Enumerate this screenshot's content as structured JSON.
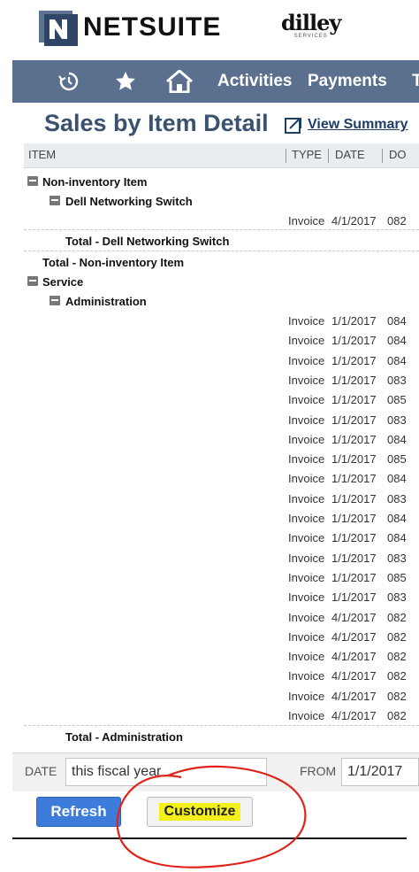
{
  "brand": {
    "logo_name": "NETSUITE",
    "partner_name": "dilley",
    "partner_sub": "SERVICES"
  },
  "nav": {
    "activities": "Activities",
    "payments": "Payments",
    "overflow": "T"
  },
  "page": {
    "title": "Sales by Item Detail",
    "view_summary": "View Summary"
  },
  "columns": {
    "item": "ITEM",
    "type": "TYPE",
    "date": "DATE",
    "doc": "DO"
  },
  "groups": {
    "noninventory": "Non-inventory Item",
    "dell": "Dell Networking Switch",
    "total_dell": "Total - Dell Networking Switch",
    "total_noninventory": "Total - Non-inventory Item",
    "service": "Service",
    "administration": "Administration",
    "total_administration": "Total - Administration"
  },
  "dell_rows": [
    {
      "type": "Invoice",
      "date": "4/1/2017",
      "doc": "082"
    }
  ],
  "admin_rows": [
    {
      "type": "Invoice",
      "date": "1/1/2017",
      "doc": "084"
    },
    {
      "type": "Invoice",
      "date": "1/1/2017",
      "doc": "084"
    },
    {
      "type": "Invoice",
      "date": "1/1/2017",
      "doc": "084"
    },
    {
      "type": "Invoice",
      "date": "1/1/2017",
      "doc": "083"
    },
    {
      "type": "Invoice",
      "date": "1/1/2017",
      "doc": "085"
    },
    {
      "type": "Invoice",
      "date": "1/1/2017",
      "doc": "083"
    },
    {
      "type": "Invoice",
      "date": "1/1/2017",
      "doc": "084"
    },
    {
      "type": "Invoice",
      "date": "1/1/2017",
      "doc": "085"
    },
    {
      "type": "Invoice",
      "date": "1/1/2017",
      "doc": "084"
    },
    {
      "type": "Invoice",
      "date": "1/1/2017",
      "doc": "083"
    },
    {
      "type": "Invoice",
      "date": "1/1/2017",
      "doc": "084"
    },
    {
      "type": "Invoice",
      "date": "1/1/2017",
      "doc": "084"
    },
    {
      "type": "Invoice",
      "date": "1/1/2017",
      "doc": "083"
    },
    {
      "type": "Invoice",
      "date": "1/1/2017",
      "doc": "085"
    },
    {
      "type": "Invoice",
      "date": "1/1/2017",
      "doc": "083"
    },
    {
      "type": "Invoice",
      "date": "4/1/2017",
      "doc": "082"
    },
    {
      "type": "Invoice",
      "date": "4/1/2017",
      "doc": "082"
    },
    {
      "type": "Invoice",
      "date": "4/1/2017",
      "doc": "082"
    },
    {
      "type": "Invoice",
      "date": "4/1/2017",
      "doc": "082"
    },
    {
      "type": "Invoice",
      "date": "4/1/2017",
      "doc": "082"
    },
    {
      "type": "Invoice",
      "date": "4/1/2017",
      "doc": "082"
    }
  ],
  "filters": {
    "date_label": "DATE",
    "date_value": "this fiscal year",
    "from_label": "FROM",
    "from_value": "1/1/2017"
  },
  "buttons": {
    "refresh": "Refresh",
    "customize": "Customize"
  },
  "icons": [
    "recent-icon",
    "star-icon",
    "home-icon",
    "view-summary-icon",
    "collapse-icon"
  ],
  "colors": {
    "navbar": "#5b6f8e",
    "title": "#3b5170",
    "refresh": "#3d7cdb",
    "highlight": "#f3f01c",
    "annotation": "#e0241b"
  }
}
